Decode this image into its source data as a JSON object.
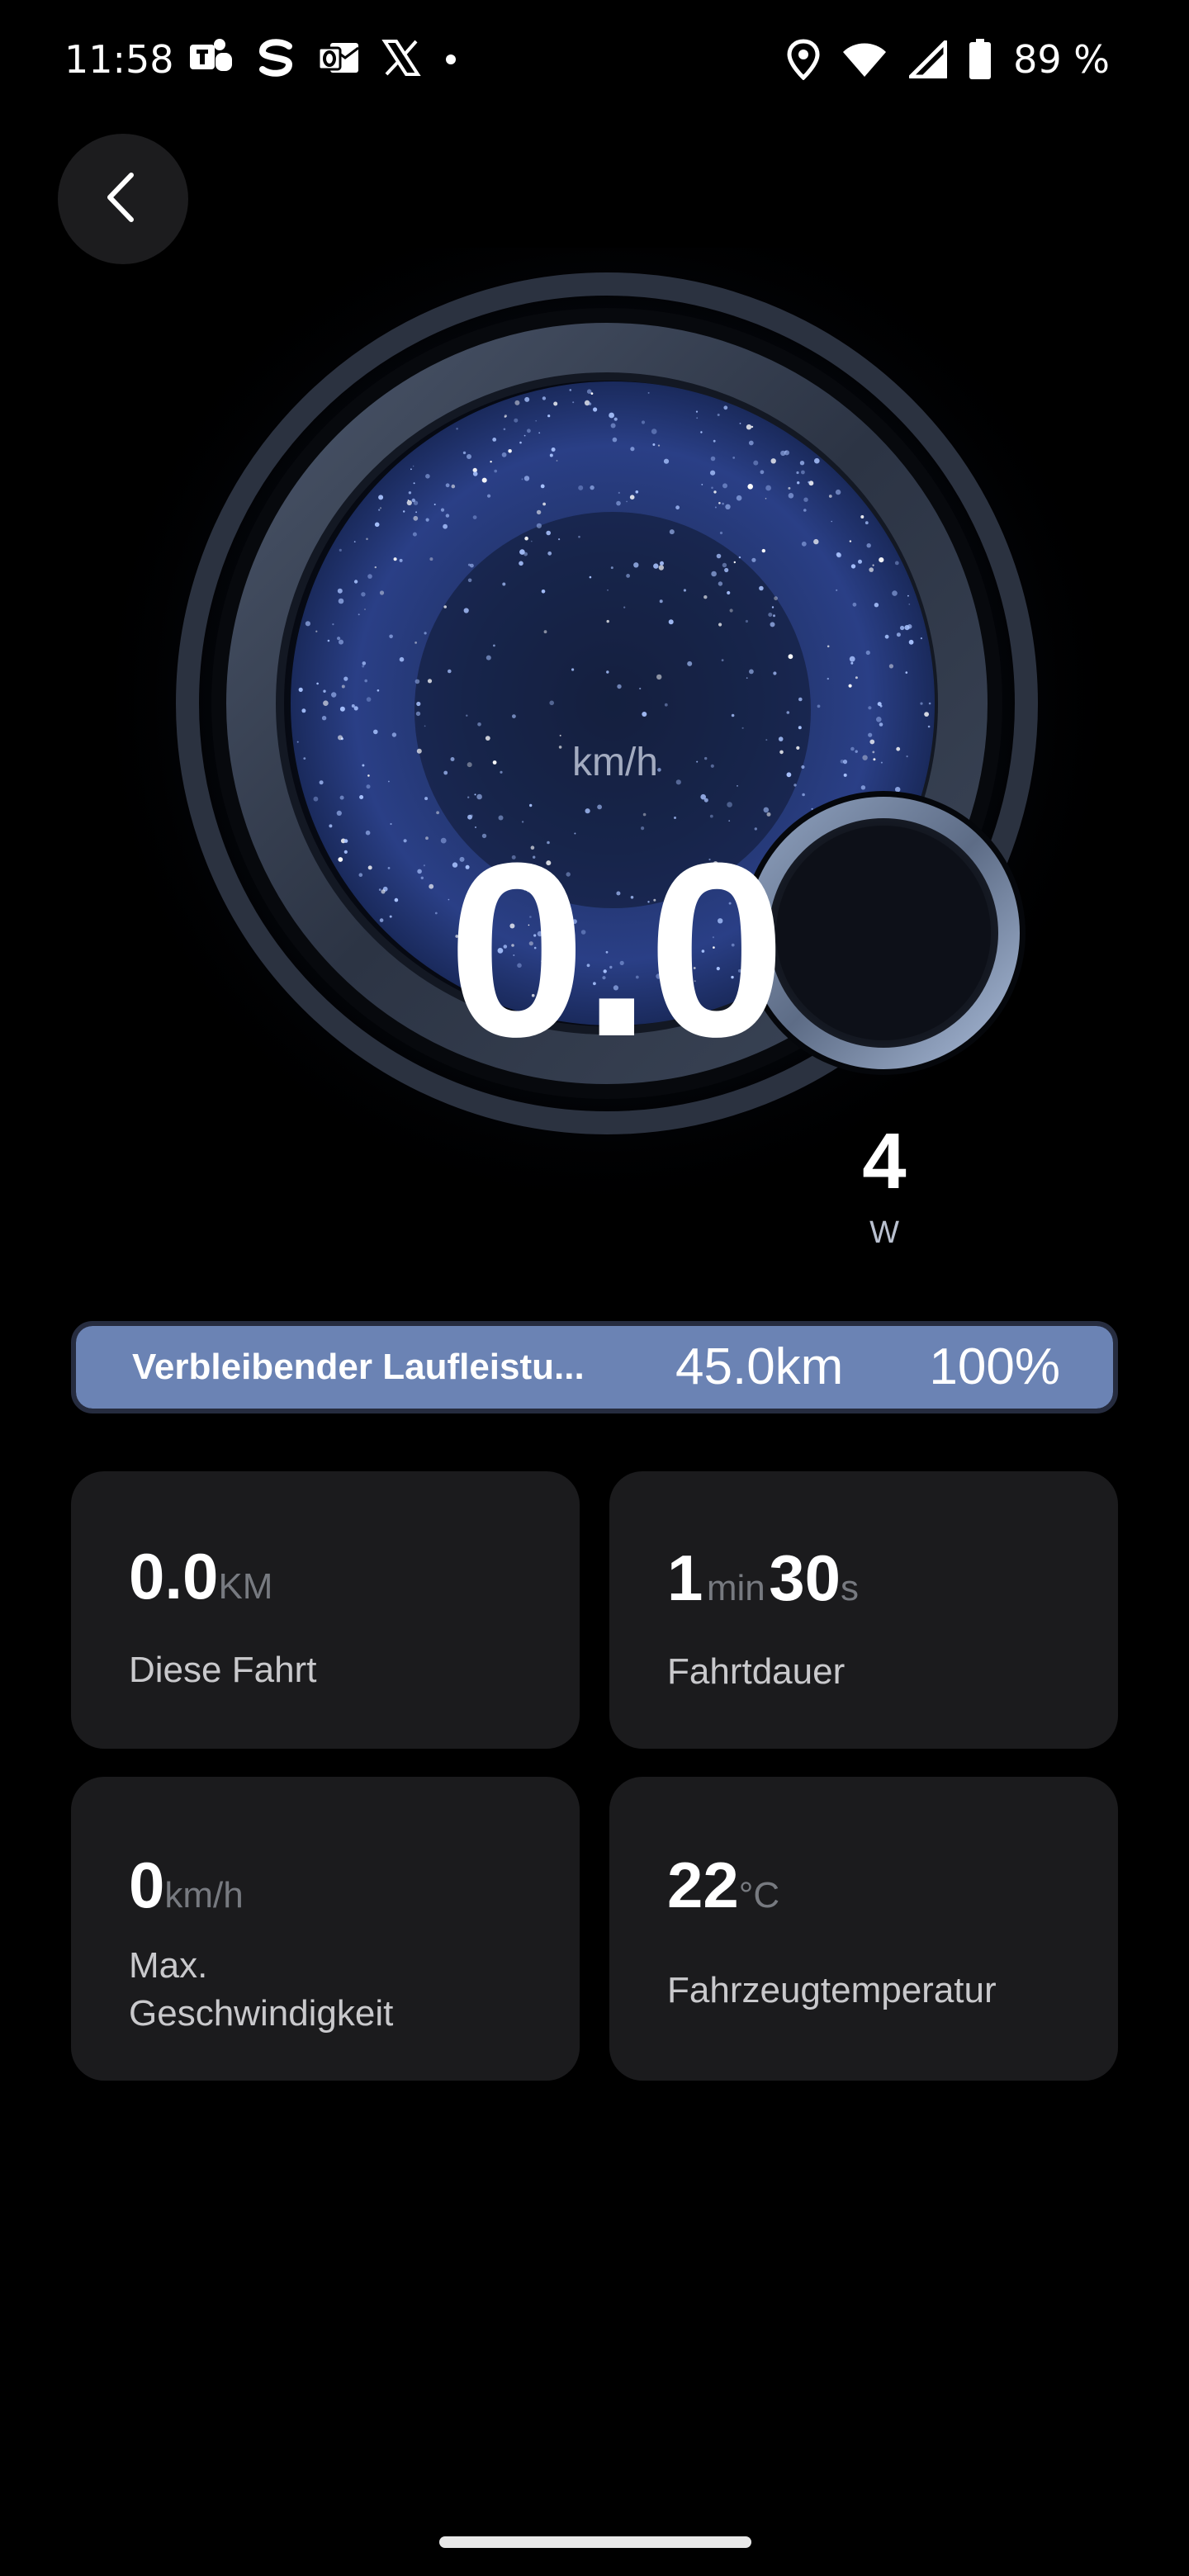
{
  "status_bar": {
    "time": "11:58",
    "notification_icons": [
      "teams-icon",
      "s-app-icon",
      "outlook-icon",
      "x-icon",
      "dot-icon"
    ],
    "right_icons": [
      "location-icon",
      "wifi-icon",
      "signal-icon",
      "battery-icon"
    ],
    "battery_percent": "89 %"
  },
  "back_button": {
    "icon": "chevron-left-icon"
  },
  "speedometer": {
    "speed": "0.0",
    "unit": "km/h",
    "power": "4",
    "power_unit": "W"
  },
  "range": {
    "label": "Verbleibender Laufleistu...",
    "distance": "45.0km",
    "percent": "100%",
    "level": 1.0,
    "fill_color": "#6b83b4"
  },
  "stats": {
    "trip": {
      "value": "0.0",
      "unit": "KM",
      "label": "Diese Fahrt"
    },
    "duration": {
      "minutes": "1",
      "min_unit": "min",
      "seconds": "30",
      "sec_unit": "s",
      "label": "Fahrtdauer"
    },
    "max_speed": {
      "value": "0",
      "unit": "km/h",
      "label_line1": "Max.",
      "label_line2": "Geschwindigkeit"
    },
    "temperature": {
      "value": "22",
      "unit": "°C",
      "label": "Fahrzeugtemperatur"
    }
  }
}
